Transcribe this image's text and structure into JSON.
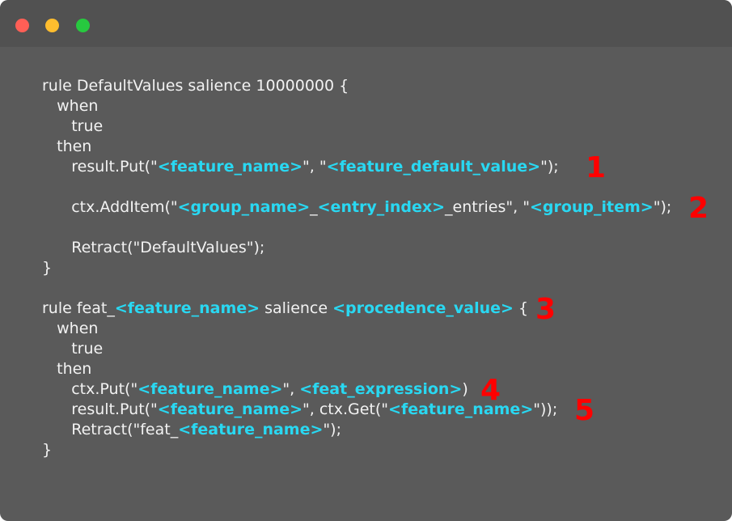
{
  "window": {
    "buttons": {
      "close": "close",
      "minimize": "minimize",
      "maximize": "maximize"
    },
    "colors": {
      "background": "#5a5a5a",
      "titlebar": "#515151",
      "text": "#f2f2f2",
      "placeholder": "#29d8f2",
      "marker": "#ff0000",
      "close_dot": "#ff5f56",
      "minimize_dot": "#ffbd2e",
      "maximize_dot": "#27c93f"
    }
  },
  "code": {
    "lines": [
      {
        "segments": [
          {
            "text": "rule DefaultValues salience 10000000 {",
            "ph": false
          }
        ]
      },
      {
        "segments": [
          {
            "text": "   when",
            "ph": false
          }
        ]
      },
      {
        "segments": [
          {
            "text": "      true",
            "ph": false
          }
        ]
      },
      {
        "segments": [
          {
            "text": "   then",
            "ph": false
          }
        ]
      },
      {
        "segments": [
          {
            "text": "      result.Put(\"",
            "ph": false
          },
          {
            "text": "<feature_name>",
            "ph": true
          },
          {
            "text": "\", \"",
            "ph": false
          },
          {
            "text": "<feature_default_value>",
            "ph": true
          },
          {
            "text": "\");",
            "ph": false
          }
        ]
      },
      {
        "segments": [
          {
            "text": "",
            "ph": false
          }
        ]
      },
      {
        "segments": [
          {
            "text": "      ctx.AddItem(\"",
            "ph": false
          },
          {
            "text": "<group_name>",
            "ph": true
          },
          {
            "text": "_",
            "ph": false
          },
          {
            "text": "<entry_index>",
            "ph": true
          },
          {
            "text": "_entries\", \"",
            "ph": false
          },
          {
            "text": "<group_item>",
            "ph": true
          },
          {
            "text": "\");",
            "ph": false
          }
        ]
      },
      {
        "segments": [
          {
            "text": "",
            "ph": false
          }
        ]
      },
      {
        "segments": [
          {
            "text": "      Retract(\"DefaultValues\");",
            "ph": false
          }
        ]
      },
      {
        "segments": [
          {
            "text": "}",
            "ph": false
          }
        ]
      },
      {
        "segments": [
          {
            "text": "",
            "ph": false
          }
        ]
      },
      {
        "segments": [
          {
            "text": "rule feat_",
            "ph": false
          },
          {
            "text": "<feature_name>",
            "ph": true
          },
          {
            "text": " salience ",
            "ph": false
          },
          {
            "text": "<procedence_value>",
            "ph": true
          },
          {
            "text": " {",
            "ph": false
          }
        ]
      },
      {
        "segments": [
          {
            "text": "   when",
            "ph": false
          }
        ]
      },
      {
        "segments": [
          {
            "text": "      true",
            "ph": false
          }
        ]
      },
      {
        "segments": [
          {
            "text": "   then",
            "ph": false
          }
        ]
      },
      {
        "segments": [
          {
            "text": "      ctx.Put(\"",
            "ph": false
          },
          {
            "text": "<feature_name>",
            "ph": true
          },
          {
            "text": "\", ",
            "ph": false
          },
          {
            "text": "<feat_expression>",
            "ph": true
          },
          {
            "text": ")",
            "ph": false
          }
        ]
      },
      {
        "segments": [
          {
            "text": "      result.Put(\"",
            "ph": false
          },
          {
            "text": "<feature_name>",
            "ph": true
          },
          {
            "text": "\", ctx.Get(\"",
            "ph": false
          },
          {
            "text": "<feature_name>",
            "ph": true
          },
          {
            "text": "\"));",
            "ph": false
          }
        ]
      },
      {
        "segments": [
          {
            "text": "      Retract(\"feat_",
            "ph": false
          },
          {
            "text": "<feature_name>",
            "ph": true
          },
          {
            "text": "\");",
            "ph": false
          }
        ]
      },
      {
        "segments": [
          {
            "text": "}",
            "ph": false
          }
        ]
      }
    ]
  },
  "markers": [
    "1",
    "2",
    "3",
    "4",
    "5"
  ]
}
